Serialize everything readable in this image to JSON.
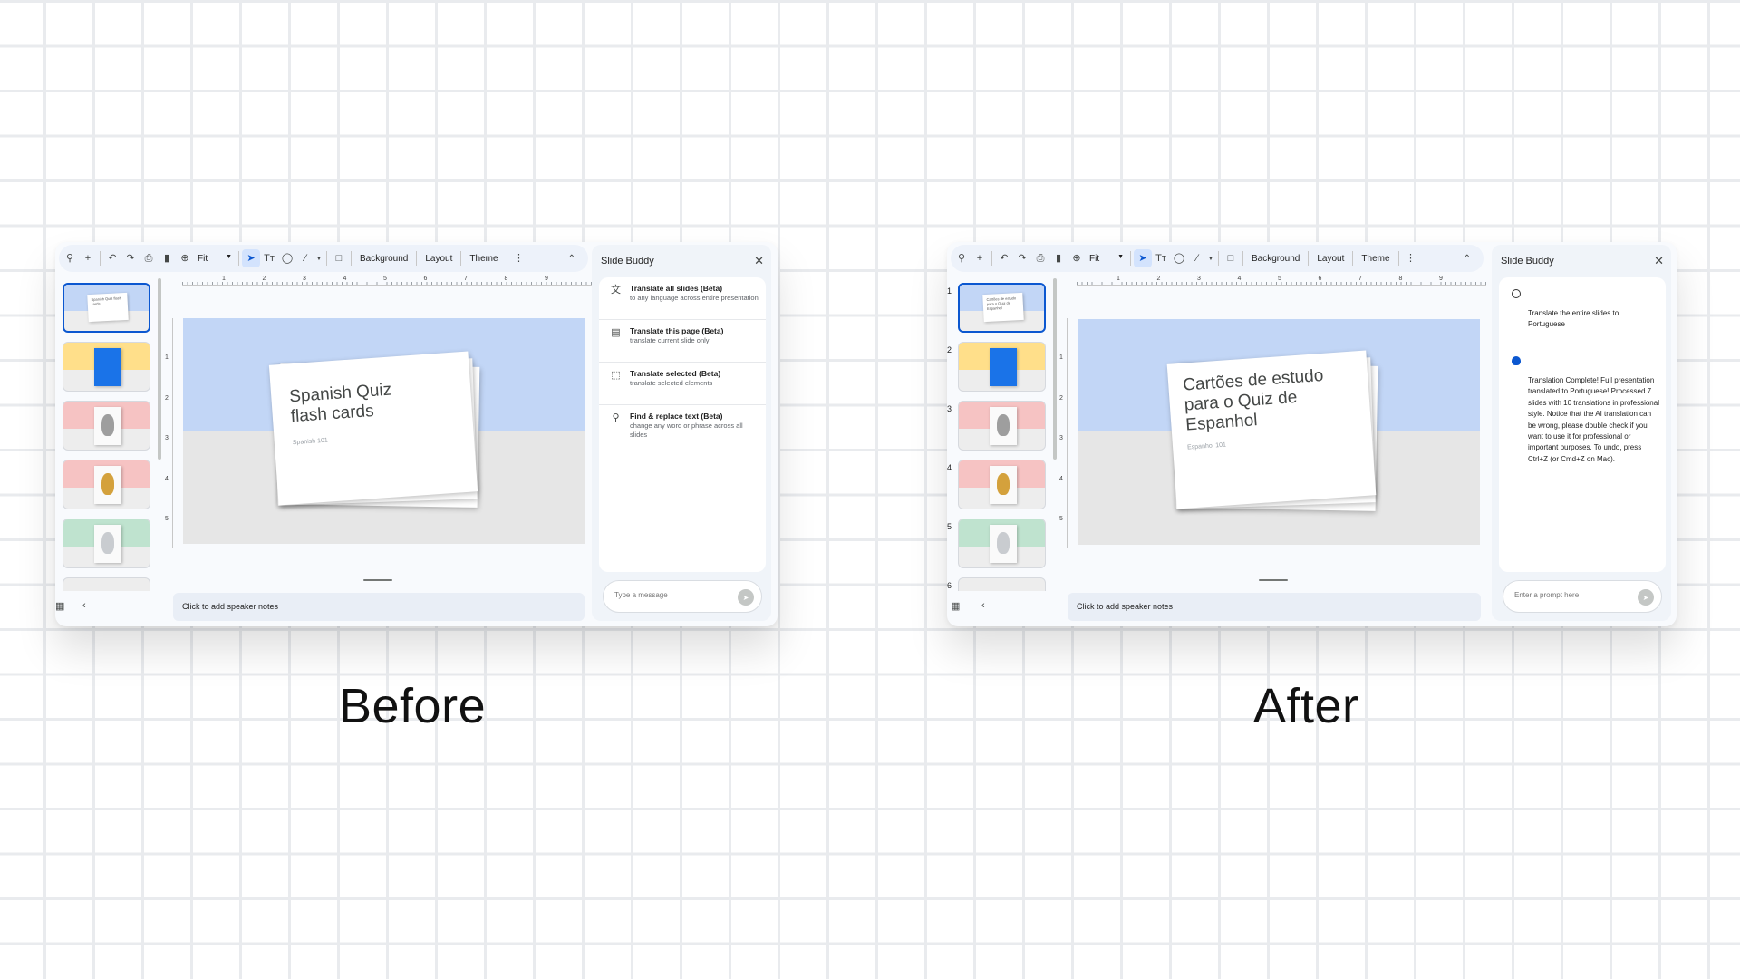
{
  "colors": {
    "accent": "#0b57d0",
    "sky": "#c2d6f6",
    "yellow": "#ffdf8a",
    "pink": "#f6c3c3",
    "green": "#bfe3cf"
  },
  "toolbar": {
    "icons": [
      "search-icon",
      "add-icon",
      "undo-icon",
      "redo-icon",
      "print-icon",
      "paint-format-icon",
      "zoom-icon"
    ],
    "zoom_value": "Fit",
    "background_label": "Background",
    "layout_label": "Layout",
    "theme_label": "Theme"
  },
  "ruler": {
    "top_marks": [
      "1",
      "2",
      "3",
      "4",
      "5",
      "6",
      "7",
      "8",
      "9"
    ],
    "left_marks": [
      "1",
      "2",
      "3",
      "4",
      "5"
    ]
  },
  "before": {
    "label": "Before",
    "slide_title": "Spanish Quiz\nflash cards",
    "slide_subtitle": "Spanish 101",
    "thumb_title": "Spanish Quiz flash cards",
    "notes": "Click to add speaker notes",
    "buddy_title": "Slide Buddy",
    "options": [
      {
        "icon": "translate-icon",
        "title": "Translate all slides (Beta)",
        "desc": "to any language across entire presentation"
      },
      {
        "icon": "page-icon",
        "title": "Translate this page (Beta)",
        "desc": "translate current slide only"
      },
      {
        "icon": "select-icon",
        "title": "Translate selected (Beta)",
        "desc": "translate selected elements"
      },
      {
        "icon": "find-replace-icon",
        "title": "Find & replace text (Beta)",
        "desc": "change any word or phrase across all slides"
      }
    ],
    "input_placeholder": "Type a message"
  },
  "after": {
    "label": "After",
    "slide_title": "Cartões de estudo\npara o Quiz de\nEspanhol",
    "slide_subtitle": "Espanhol 101",
    "thumb_title": "Cartões de estudo para o Quiz de Espanhol",
    "thumb_numbers": [
      "1",
      "2",
      "3",
      "4",
      "5",
      "6"
    ],
    "notes": "Click to add speaker notes",
    "buddy_title": "Slide Buddy",
    "user_message": "Translate the entire slides to Portuguese",
    "ai_message": "Translation Complete! Full presentation translated to Portuguese! Processed 7 slides with 10 translations in professional style. Notice that the AI translation can be wrong, please double check if you want to use it for professional or important purposes. To undo, press Ctrl+Z (or Cmd+Z on Mac).",
    "input_placeholder": "Enter a prompt here"
  }
}
